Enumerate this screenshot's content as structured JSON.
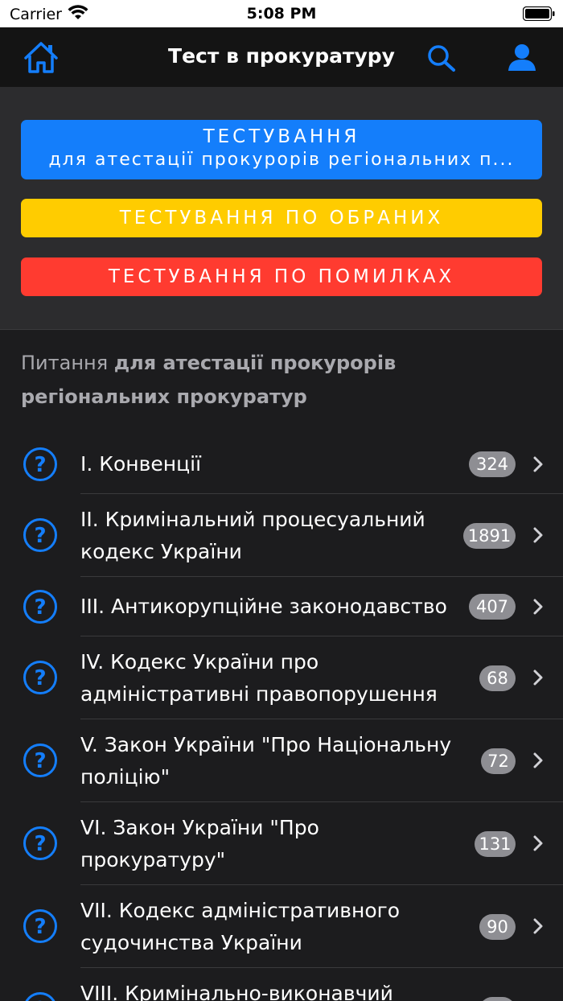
{
  "status_bar": {
    "carrier": "Carrier",
    "time": "5:08 PM"
  },
  "nav": {
    "title": "Тест в прокуратуру"
  },
  "buttons": {
    "testing_line1": "ТЕСТУВАННЯ",
    "testing_line2": "для атестації прокурорів регіональних п...",
    "favorites": "ТЕСТУВАННЯ ПО ОБРАНИХ",
    "mistakes": "ТЕСТУВАННЯ ПО ПОМИЛКАХ"
  },
  "colors": {
    "blue": "#147efb",
    "yellow": "#ffcc00",
    "red": "#ff3b30",
    "badge": "#8e8e93"
  },
  "section": {
    "prefix": "Питання ",
    "bold_line1": "для атестації прокурорів",
    "bold_line2": "регіональних прокуратур"
  },
  "items": [
    {
      "line1": "I. Конвенції",
      "line2": "",
      "count": "324"
    },
    {
      "line1": "II. Кримінальний процесуальний",
      "line2": "кодекс України",
      "count": "1891"
    },
    {
      "line1": "III. Антикорупційне законодавство",
      "line2": "",
      "count": "407"
    },
    {
      "line1": "IV. Кодекс України про",
      "line2": "адміністративні правопорушення",
      "count": "68"
    },
    {
      "line1": "V. Закон України \"Про Національну",
      "line2": "поліцію\"",
      "count": "72"
    },
    {
      "line1": "VI. Закон України \"Про",
      "line2": "прокуратуру\"",
      "count": "131"
    },
    {
      "line1": "VII. Кодекс адміністративного",
      "line2": "судочинства України",
      "count": "90"
    },
    {
      "line1": "VIII. Кримінально-виконавчий",
      "line2": "",
      "count": ""
    }
  ]
}
